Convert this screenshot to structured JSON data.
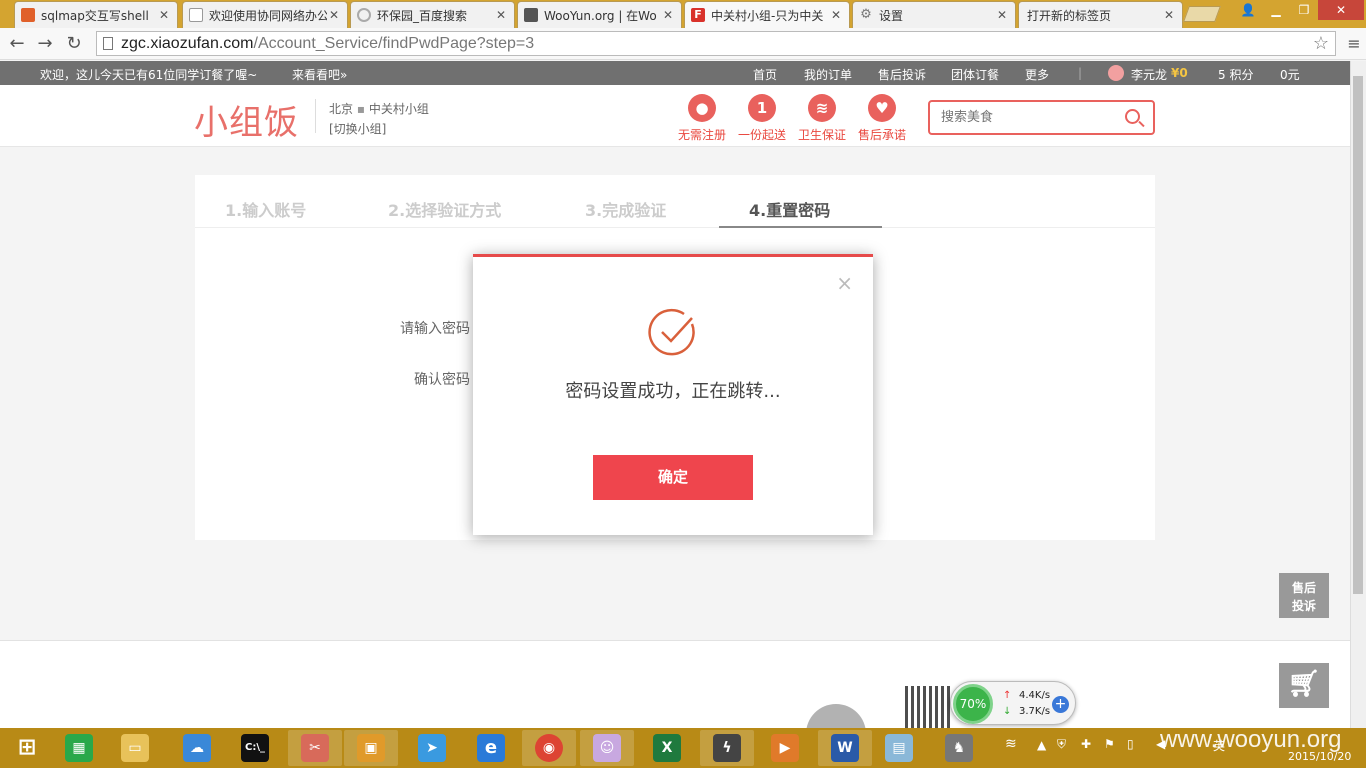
{
  "browser": {
    "tabs": [
      {
        "label": "sqlmap交互写shell",
        "favicon_color": "#e0602a"
      },
      {
        "label": "欢迎使用协同网络办公",
        "favicon_color": "#cccccc"
      },
      {
        "label": "环保园_百度搜索",
        "favicon_color": "#aaaaaa"
      },
      {
        "label": "WooYun.org | 在Wo",
        "favicon_color": "#555555"
      },
      {
        "label": "中关村小组-只为中关",
        "favicon_color": "#d9322b"
      },
      {
        "label": "设置",
        "favicon_color": "#777777"
      },
      {
        "label": "打开新的标签页",
        "favicon_color": ""
      }
    ],
    "active_tab_index": 4,
    "url_domain": "zgc.xiaozufan.com",
    "url_path": "/Account_Service/findPwdPage?step=3"
  },
  "sitetop": {
    "welcome": "欢迎，这儿今天已有61位同学订餐了喔~",
    "look": "来看看吧»",
    "nav": [
      "首页",
      "我的订单",
      "售后投诉",
      "团体订餐",
      "更多"
    ],
    "user_name": "李元龙",
    "coin": "¥0",
    "points": "5 积分",
    "balance": "0元"
  },
  "header": {
    "logo": "小组饭",
    "city": "北京",
    "group": "中关村小组",
    "switch_group": "[切换小组]",
    "features": [
      {
        "icon": "user-icon",
        "label": "无需注册"
      },
      {
        "icon": "number-one-icon",
        "label": "一份起送"
      },
      {
        "icon": "hygiene-icon",
        "label": "卫生保证"
      },
      {
        "icon": "heart-icon",
        "label": "售后承诺"
      }
    ],
    "search_placeholder": "搜索美食"
  },
  "steps": [
    "1.输入账号",
    "2.选择验证方式",
    "3.完成验证",
    "4.重置密码"
  ],
  "current_step": 4,
  "form": {
    "password_label": "请输入密码",
    "confirm_label": "确认密码"
  },
  "modal": {
    "close_symbol": "×",
    "message": "密码设置成功，正在跳转...",
    "ok_label": "确定",
    "accent_color": "#ef454d"
  },
  "sidebar": {
    "complaint_line1": "售后",
    "complaint_line2": "投诉"
  },
  "netmon": {
    "percent": "70%",
    "up_rate": "4.4K/s",
    "down_rate": "3.7K/s"
  },
  "taskbar": {
    "tray_lang": "英",
    "date": "2015/10/20",
    "watermark": "www.wooyun.org"
  }
}
